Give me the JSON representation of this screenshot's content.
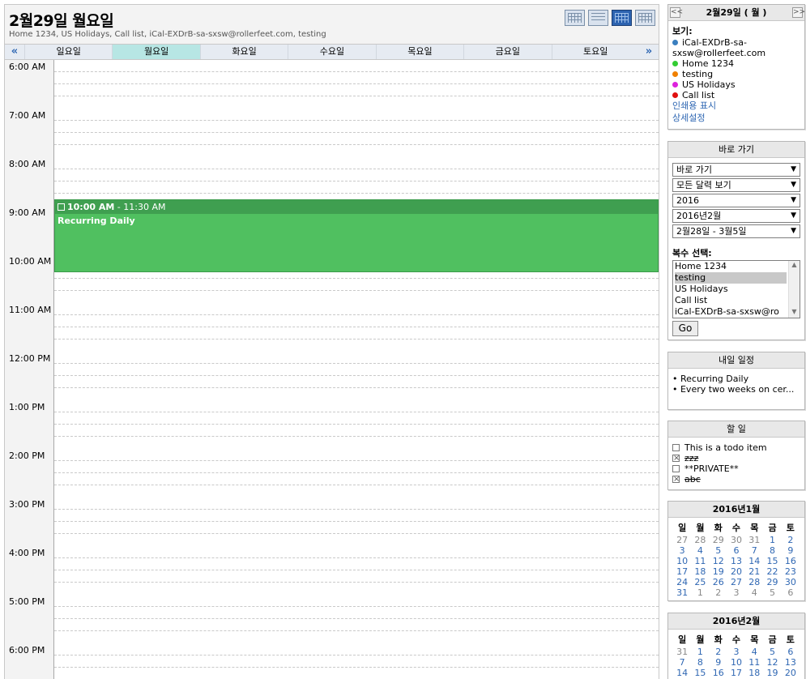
{
  "header": {
    "title": "2월29일 월요일",
    "subtitle": "Home 1234, US Holidays, Call list, iCal-EXDrB-sa-sxsw@rollerfeet.com, testing"
  },
  "days": {
    "prev": "«",
    "next": "»",
    "names": [
      "일요일",
      "월요일",
      "화요일",
      "수요일",
      "목요일",
      "금요일",
      "토요일"
    ]
  },
  "hours": [
    "6:00 AM",
    "7:00 AM",
    "8:00 AM",
    "9:00 AM",
    "10:00 AM",
    "11:00 AM",
    "12:00 PM",
    "1:00 PM",
    "2:00 PM",
    "3:00 PM",
    "4:00 PM",
    "5:00 PM",
    "6:00 PM"
  ],
  "event": {
    "start": "10:00 AM",
    "end": " - 11:30 AM",
    "title": "Recurring Daily",
    "color": "#50c060"
  },
  "sidebar": {
    "date_box": {
      "title": "2월29일 ( 월 )",
      "prev": "<<",
      "next": ">>",
      "view_label": "보기:",
      "calendars": [
        {
          "name": "iCal-EXDrB-sa-sxsw@rollerfeet.com",
          "color": "#3a7fbf"
        },
        {
          "name": "Home 1234",
          "color": "#33cc33"
        },
        {
          "name": "testing",
          "color": "#f08000"
        },
        {
          "name": "US Holidays",
          "color": "#dd22dd"
        },
        {
          "name": "Call list",
          "color": "#e01010"
        }
      ],
      "print_link": "인쇄용 표시",
      "settings_link": "상세설정"
    },
    "goto": {
      "title": "바로 가기",
      "selects": [
        "바로 가기",
        "모든 달력 보기",
        "2016",
        "2016년2월",
        "2월28일 - 3월5일"
      ],
      "multi_label": "복수 선택:",
      "options": [
        "Home 1234",
        "testing",
        "US Holidays",
        "Call list",
        "iCal-EXDrB-sa-sxsw@ro"
      ],
      "go": "Go"
    },
    "tomorrow": {
      "title": "내일 일정",
      "items": [
        "• Recurring Daily",
        "• Every two weeks on cer..."
      ]
    },
    "todo": {
      "title": "할 일",
      "items": [
        {
          "text": "This is a todo item",
          "done": false
        },
        {
          "text": "zzz",
          "done": true
        },
        {
          "text": "**PRIVATE**",
          "done": false
        },
        {
          "text": "abc",
          "done": true
        }
      ]
    },
    "weekday_short": [
      "일",
      "월",
      "화",
      "수",
      "목",
      "금",
      "토"
    ],
    "jan": {
      "title": "2016년1월",
      "weeks": [
        [
          "27",
          "28",
          "29",
          "30",
          "31",
          "1",
          "2"
        ],
        [
          "3",
          "4",
          "5",
          "6",
          "7",
          "8",
          "9"
        ],
        [
          "10",
          "11",
          "12",
          "13",
          "14",
          "15",
          "16"
        ],
        [
          "17",
          "18",
          "19",
          "20",
          "21",
          "22",
          "23"
        ],
        [
          "24",
          "25",
          "26",
          "27",
          "28",
          "29",
          "30"
        ],
        [
          "31",
          "1",
          "2",
          "3",
          "4",
          "5",
          "6"
        ]
      ]
    },
    "feb": {
      "title": "2016년2월",
      "weeks": [
        [
          "31",
          "1",
          "2",
          "3",
          "4",
          "5",
          "6"
        ],
        [
          "7",
          "8",
          "9",
          "10",
          "11",
          "12",
          "13"
        ],
        [
          "14",
          "15",
          "16",
          "17",
          "18",
          "19",
          "20"
        ]
      ]
    }
  }
}
